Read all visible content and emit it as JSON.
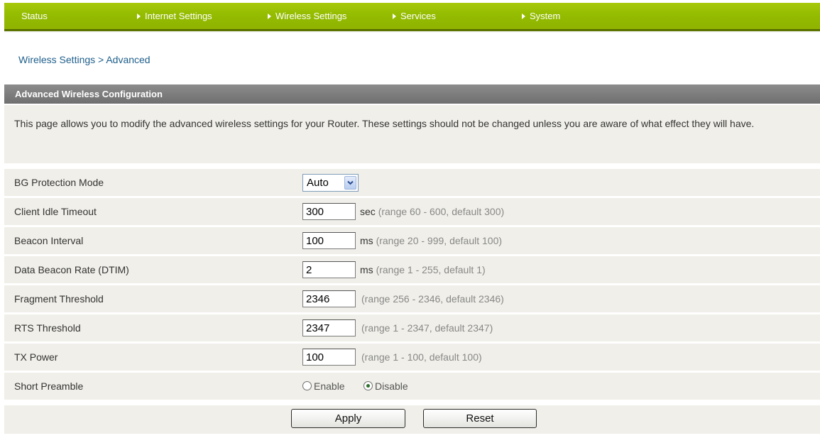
{
  "nav": {
    "items": [
      {
        "label": "Status",
        "has_arrow": false
      },
      {
        "label": "Internet Settings",
        "has_arrow": true
      },
      {
        "label": "Wireless Settings",
        "has_arrow": true
      },
      {
        "label": "Services",
        "has_arrow": true
      },
      {
        "label": "System",
        "has_arrow": true
      }
    ]
  },
  "breadcrumb": "Wireless Settings > Advanced",
  "panel": {
    "title": "Advanced Wireless Configuration",
    "description": "This page allows you to modify the advanced wireless settings for your Router. These settings should not be changed unless you are aware of what effect they will have."
  },
  "fields": {
    "bg_protection": {
      "label": "BG Protection Mode",
      "value": "Auto"
    },
    "client_idle_timeout": {
      "label": "Client Idle Timeout",
      "value": "300",
      "unit": "sec",
      "hint": "(range 60 - 600, default 300)"
    },
    "beacon_interval": {
      "label": "Beacon Interval",
      "value": "100",
      "unit": "ms",
      "hint": "(range 20 - 999, default 100)"
    },
    "dtim": {
      "label": "Data Beacon Rate (DTIM)",
      "value": "2",
      "unit": "ms",
      "hint": "(range 1 - 255, default 1)"
    },
    "fragment_threshold": {
      "label": "Fragment Threshold",
      "value": "2346",
      "hint": "(range 256 - 2346, default 2346)"
    },
    "rts_threshold": {
      "label": "RTS Threshold",
      "value": "2347",
      "hint": "(range 1 - 2347, default 2347)"
    },
    "tx_power": {
      "label": "TX Power",
      "value": "100",
      "hint": "(range 1 - 100, default 100)"
    },
    "short_preamble": {
      "label": "Short Preamble",
      "enable_label": "Enable",
      "disable_label": "Disable",
      "selected": "Disable"
    }
  },
  "buttons": {
    "apply": "Apply",
    "reset": "Reset"
  },
  "colors": {
    "nav_green": "#94bc00",
    "header_gray": "#7a7a7a",
    "row_bg": "#f0efe9",
    "link_blue": "#1f5f8b"
  }
}
